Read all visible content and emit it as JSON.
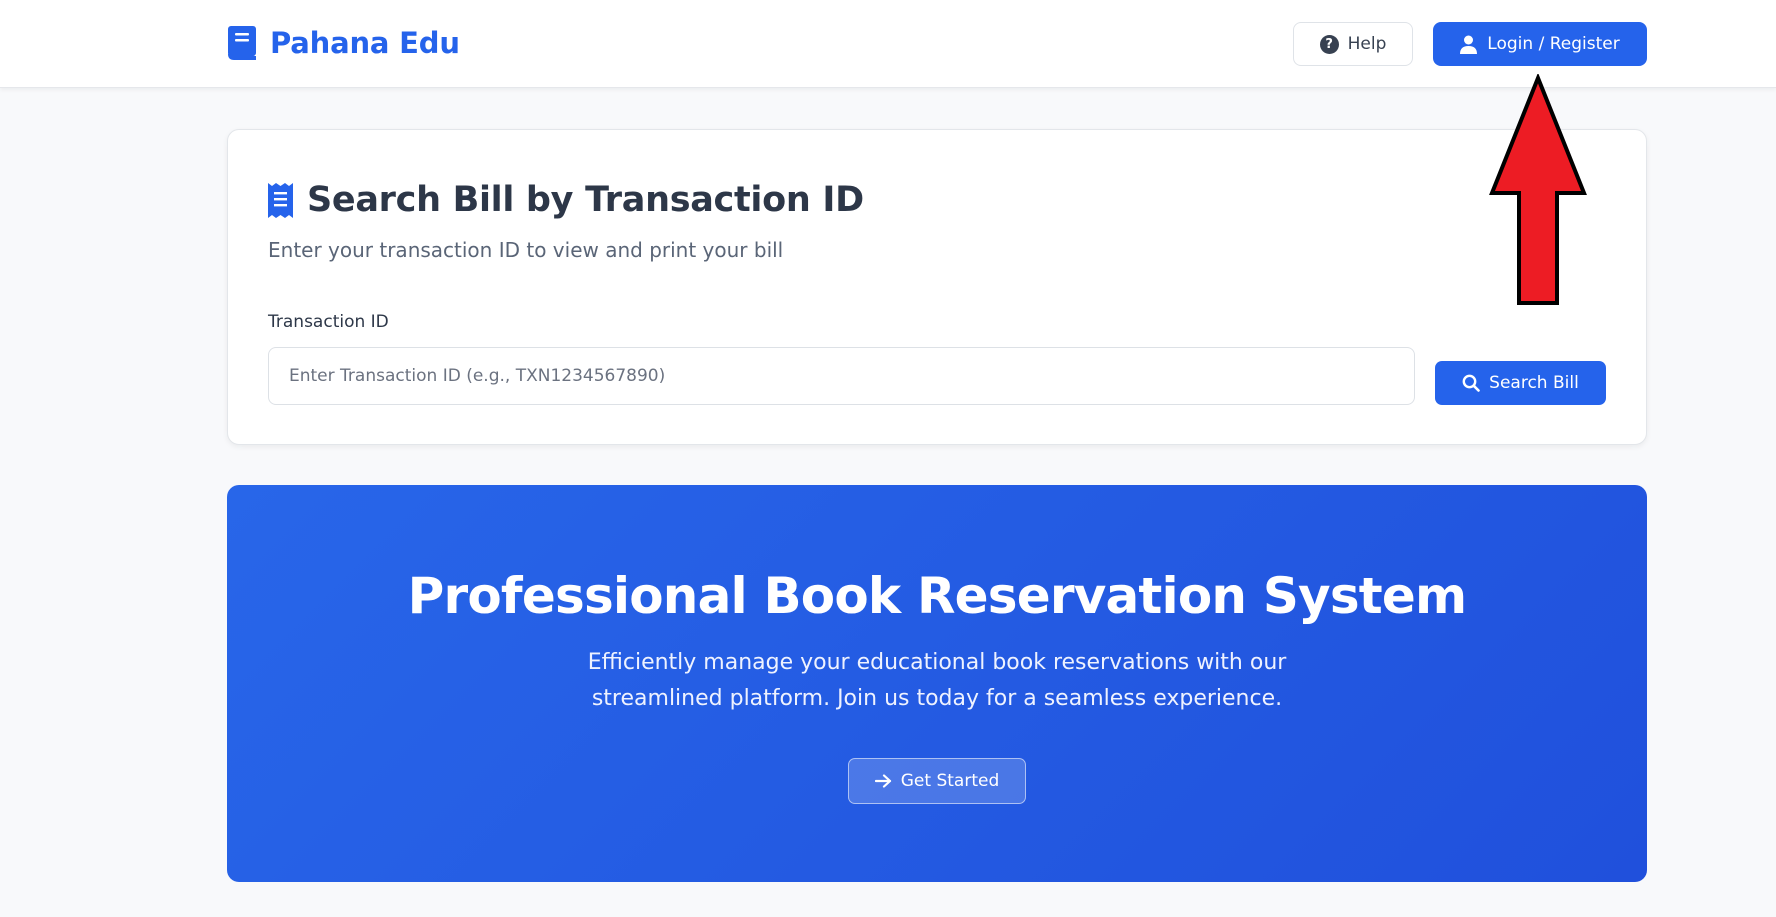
{
  "header": {
    "brand_name": "Pahana Edu",
    "brand_icon": "book-icon",
    "help_label": "Help",
    "login_label": "Login / Register"
  },
  "search_card": {
    "title": "Search Bill by Transaction ID",
    "subtitle": "Enter your transaction ID to view and print your bill",
    "field_label": "Transaction ID",
    "input_value": "",
    "input_placeholder": "Enter Transaction ID (e.g., TXN1234567890)",
    "button_label": "Search Bill"
  },
  "hero": {
    "title": "Professional Book Reservation System",
    "description": "Efficiently manage your educational book reservations with our streamlined platform. Join us today for a seamless experience.",
    "cta_label": "Get Started"
  },
  "colors": {
    "primary": "#2563eb",
    "hero_gradient_start": "#2866e9",
    "hero_gradient_end": "#2050dc",
    "annotation_arrow": "#ed1c24"
  }
}
